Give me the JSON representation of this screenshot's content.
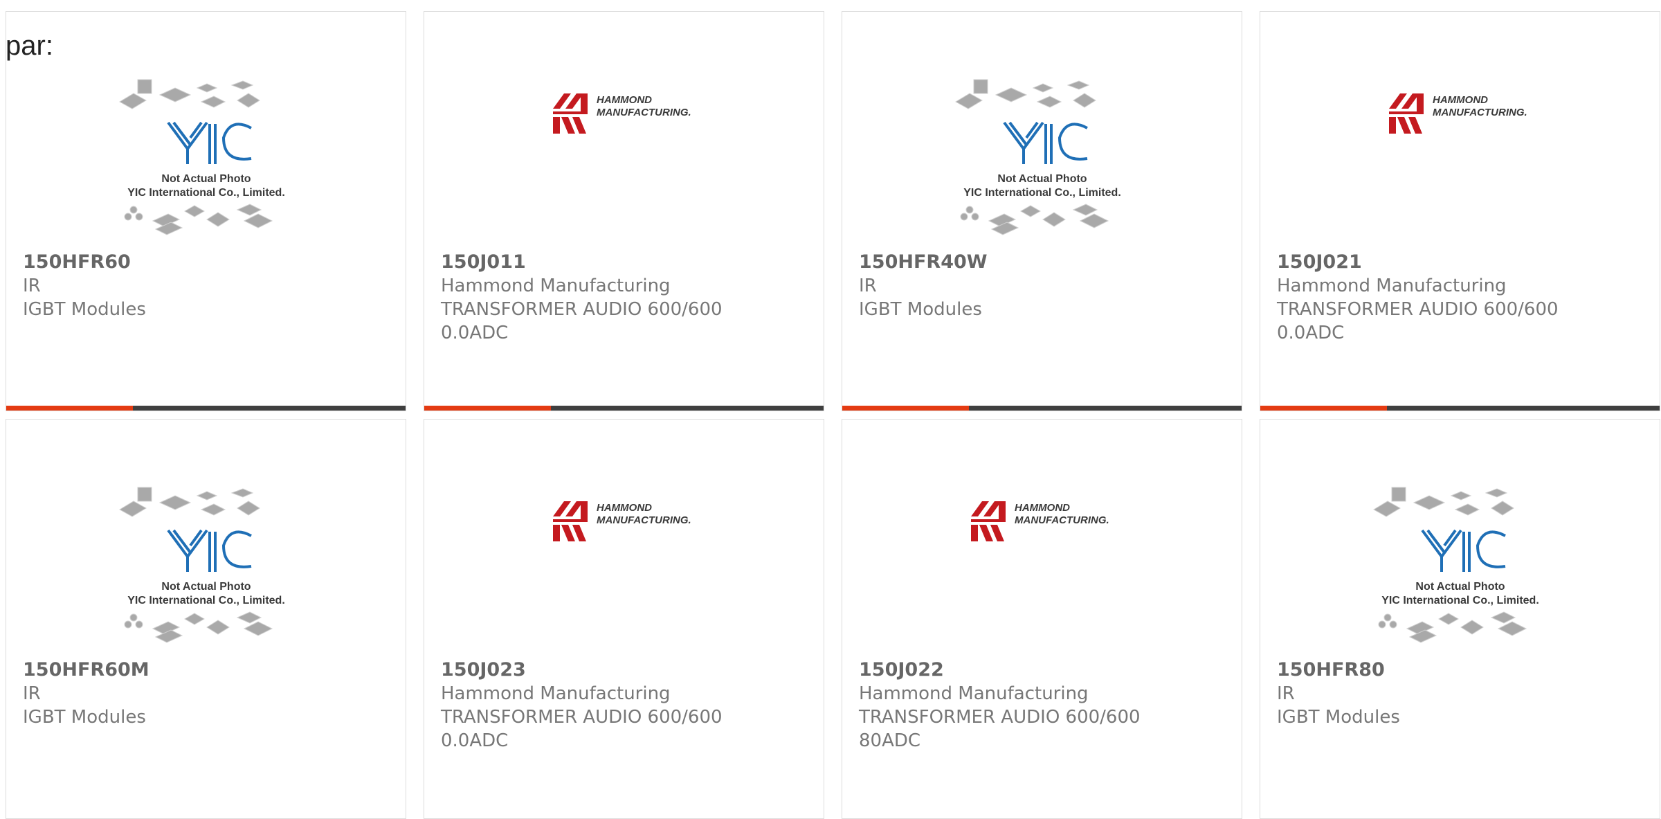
{
  "page": {
    "label": "par:"
  },
  "colors": {
    "accent": "#e43b12",
    "bar": "#3f3f3f",
    "border": "#dcdcdc",
    "text": "#777777"
  },
  "placeholder_caption": {
    "line1": "Not Actual Photo",
    "line2": "YIC International Co., Limited."
  },
  "hammond_logo": {
    "line1": "HAMMOND",
    "line2": "MANUFACTURING."
  },
  "products": [
    {
      "part": "150HFR60",
      "maker": "IR",
      "desc1": "IGBT Modules",
      "desc2": "",
      "image": "yic-placeholder"
    },
    {
      "part": "150J011",
      "maker": "Hammond Manufacturing",
      "desc1": "TRANSFORMER AUDIO 600/600",
      "desc2": "0.0ADC",
      "image": "hammond-logo"
    },
    {
      "part": "150HFR40W",
      "maker": "IR",
      "desc1": "IGBT Modules",
      "desc2": "",
      "image": "yic-placeholder"
    },
    {
      "part": "150J021",
      "maker": "Hammond Manufacturing",
      "desc1": "TRANSFORMER AUDIO 600/600",
      "desc2": "0.0ADC",
      "image": "hammond-logo"
    },
    {
      "part": "150HFR60M",
      "maker": "IR",
      "desc1": "IGBT Modules",
      "desc2": "",
      "image": "yic-placeholder"
    },
    {
      "part": "150J023",
      "maker": "Hammond Manufacturing",
      "desc1": "TRANSFORMER AUDIO 600/600",
      "desc2": "0.0ADC",
      "image": "hammond-logo"
    },
    {
      "part": "150J022",
      "maker": "Hammond Manufacturing",
      "desc1": "TRANSFORMER AUDIO 600/600",
      "desc2": "80ADC",
      "image": "hammond-logo"
    },
    {
      "part": "150HFR80",
      "maker": "IR",
      "desc1": "IGBT Modules",
      "desc2": "",
      "image": "yic-placeholder"
    }
  ]
}
